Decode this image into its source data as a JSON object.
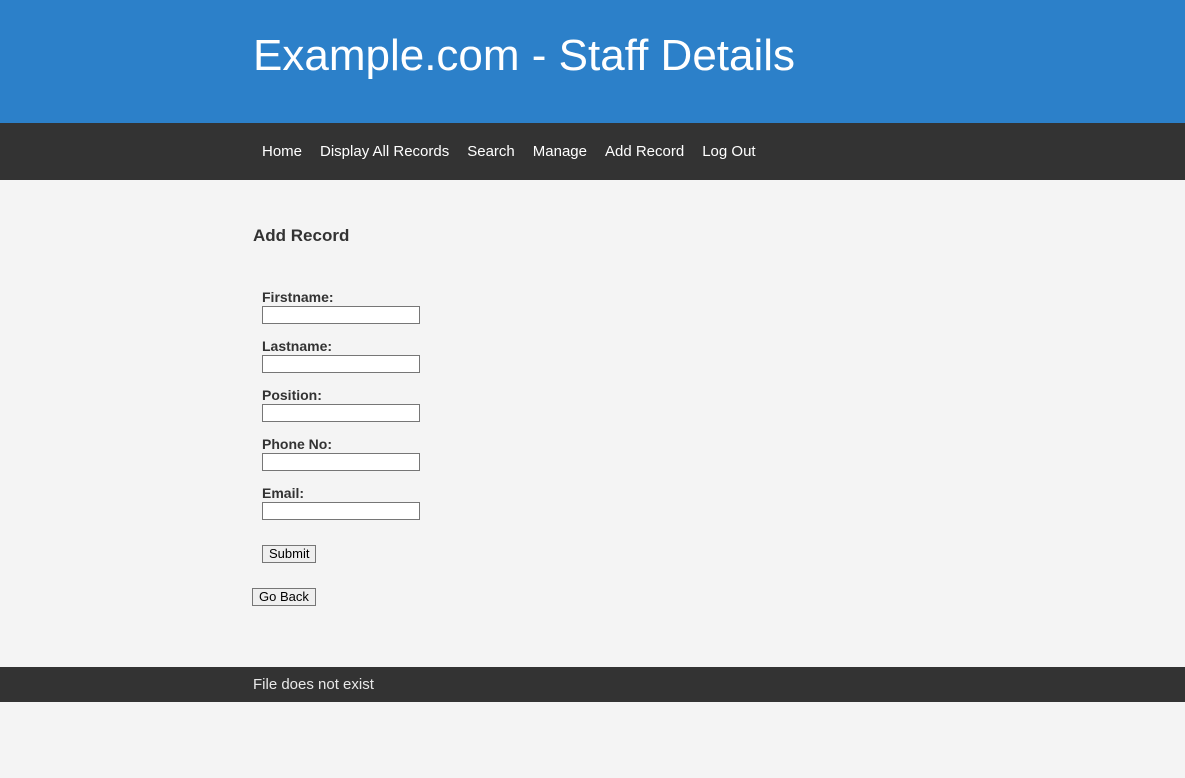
{
  "header": {
    "title": "Example.com - Staff Details"
  },
  "nav": {
    "items": [
      {
        "label": "Home"
      },
      {
        "label": "Display All Records"
      },
      {
        "label": "Search"
      },
      {
        "label": "Manage"
      },
      {
        "label": "Add Record"
      },
      {
        "label": "Log Out"
      }
    ]
  },
  "main": {
    "title": "Add Record",
    "fields": [
      {
        "label": "Firstname:",
        "value": ""
      },
      {
        "label": "Lastname:",
        "value": ""
      },
      {
        "label": "Position:",
        "value": ""
      },
      {
        "label": "Phone No:",
        "value": ""
      },
      {
        "label": "Email:",
        "value": ""
      }
    ],
    "submit_label": "Submit",
    "back_label": "Go Back"
  },
  "footer": {
    "text": "File does not exist"
  },
  "colors": {
    "header_bg": "#2c80c9",
    "nav_bg": "#333333",
    "page_bg": "#f4f4f4"
  }
}
